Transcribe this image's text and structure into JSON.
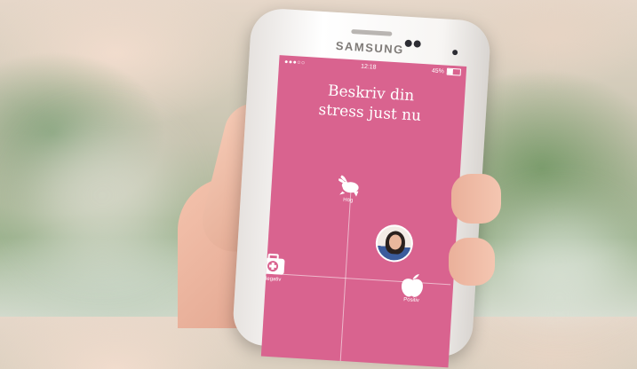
{
  "device": {
    "brand": "SAMSUNG"
  },
  "status_bar": {
    "signal": "●●●○○",
    "time": "12:18",
    "battery_text": "45%",
    "battery_level": 0.45
  },
  "screen": {
    "background_color": "#d9638f",
    "title_line1": "Beskriv din",
    "title_line2": "stress just nu"
  },
  "grid": {
    "high": {
      "label": "Hög",
      "icon": "rabbit-icon"
    },
    "negative": {
      "label": "Negativ",
      "icon": "first-aid-kit-icon"
    },
    "positive": {
      "label": "Positiv",
      "icon": "apple-icon"
    }
  },
  "marker": {
    "icon": "user-avatar"
  }
}
